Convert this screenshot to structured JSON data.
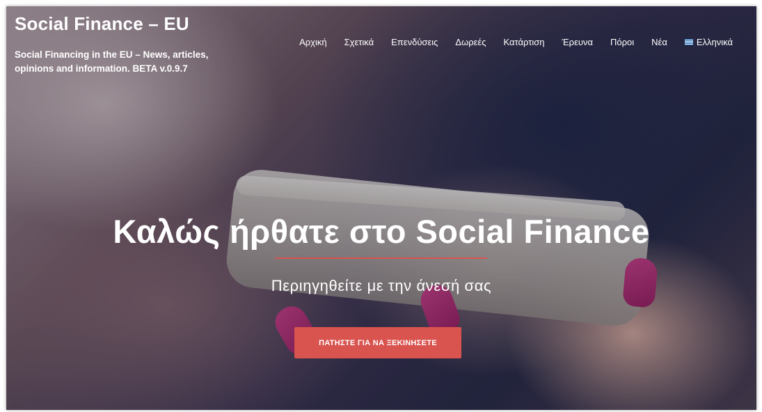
{
  "site": {
    "title": "Social Finance – EU",
    "tagline": "Social Financing in the EU – News, articles, opinions and information. BETA v.0.9.7"
  },
  "nav": {
    "items": [
      {
        "label": "Αρχική"
      },
      {
        "label": "Σχετικά"
      },
      {
        "label": "Επενδύσεις"
      },
      {
        "label": "Δωρεές"
      },
      {
        "label": "Κατάρτιση"
      },
      {
        "label": "Έρευνα"
      },
      {
        "label": "Πόροι"
      },
      {
        "label": "Νέα"
      },
      {
        "label": "Ελληνικά",
        "icon": "greek-flag-icon"
      }
    ]
  },
  "hero": {
    "headline": "Καλώς ήρθατε στο Social Finance",
    "subtitle": "Περιηγηθείτε με την άνεσή σας",
    "cta_label": "ΠΑΤΗΣΤΕ ΓΙΑ ΝΑ ΞΕΚΙΝΗΣΕΤΕ"
  },
  "colors": {
    "accent": "#d9534f",
    "text": "#ffffff"
  }
}
